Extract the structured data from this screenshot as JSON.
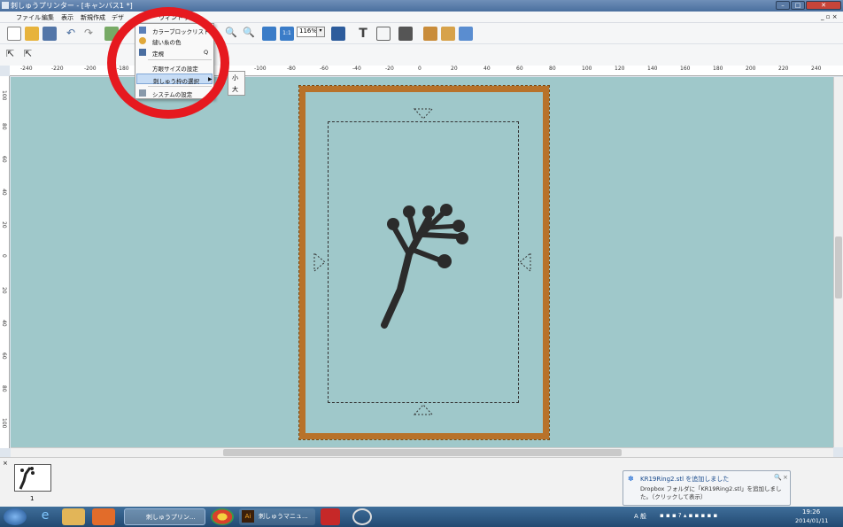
{
  "window": {
    "title": "刺しゅうプリンター - [キャンバス1 *]"
  },
  "menubar": {
    "items": [
      "ファイル",
      "編集",
      "表示",
      "新規作成",
      "デザ",
      "ウィンドウ"
    ]
  },
  "toolbar": {
    "zoom": "116%"
  },
  "dropdown": {
    "items": [
      {
        "label": "カラーブロックリスト",
        "shortcut": ""
      },
      {
        "label": "縫い糸の色",
        "shortcut": ""
      },
      {
        "label": "定規",
        "shortcut": "Q"
      },
      {
        "label": "方眼サイズの設定",
        "shortcut": ""
      },
      {
        "label": "刺しゅう枠の選択",
        "shortcut": ""
      },
      {
        "label": "システムの設定",
        "shortcut": ""
      }
    ],
    "submenu": [
      "小",
      "大"
    ]
  },
  "rulers": {
    "h": [
      "-240",
      "-220",
      "-200",
      "-180",
      "-100",
      "-80",
      "-60",
      "-40",
      "-20",
      "0",
      "20",
      "40",
      "60",
      "80",
      "100",
      "120",
      "140",
      "160",
      "180",
      "200",
      "220",
      "240"
    ],
    "v": [
      "100",
      "80",
      "60",
      "40",
      "20",
      "0",
      "20",
      "40",
      "60",
      "80",
      "100"
    ]
  },
  "thumbnail": {
    "page_number": "1"
  },
  "notification": {
    "title": "KR19Ring2.stl を追加しました",
    "body": "Dropbox フォルダに「KR19Ring2.stl」を追加しました。（クリックして表示）"
  },
  "taskbar": {
    "items": [
      "刺しゅうプリン...",
      "刺しゅうマニュ..."
    ],
    "tray_lang": "A 般",
    "time": "19:26",
    "date": "2014/01/11"
  },
  "colors": {
    "hoop": "#b8722a",
    "canvas": "#9fc8ca",
    "highlight_circle": "#e6191f"
  }
}
